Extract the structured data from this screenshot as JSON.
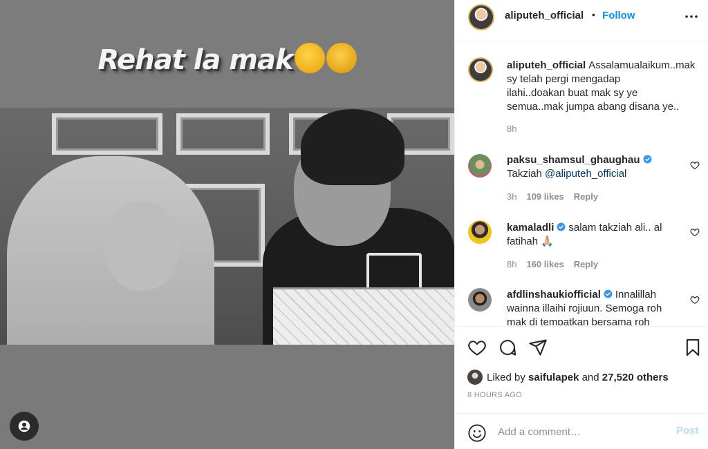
{
  "media": {
    "overlay_text": "Rehat la mak",
    "overlay_emojis": [
      "crying-face",
      "raised-hands"
    ]
  },
  "header": {
    "username": "aliputeh_official",
    "separator": "•",
    "follow_label": "Follow"
  },
  "comments": [
    {
      "username": "aliputeh_official",
      "verified": false,
      "text": "Assalamualaikum..mak sy telah pergi mengadap ilahi..doakan buat mak sy ye semua..mak jumpa abang disana ye..",
      "time": "8h"
    },
    {
      "username": "paksu_shamsul_ghaughau",
      "verified": true,
      "text_prefix": "Takziah ",
      "mention": "@aliputeh_official",
      "time": "3h",
      "likes": "109 likes",
      "reply_label": "Reply"
    },
    {
      "username": "kamaladli",
      "verified": true,
      "text": "salam takziah ali.. al fatihah 🙏🏼",
      "time": "8h",
      "likes": "160 likes",
      "reply_label": "Reply"
    },
    {
      "username": "afdlinshaukiofficial",
      "verified": true,
      "text": "Innalillah wainna illaihi rojiuun. Semoga roh mak di tempatkan bersama roh"
    }
  ],
  "likes": {
    "prefix": "Liked by",
    "user": "saifulapek",
    "conjunction": "and",
    "others": "27,520 others"
  },
  "timestamp": "8 HOURS AGO",
  "add_comment": {
    "placeholder": "Add a comment…",
    "post_label": "Post"
  },
  "colors": {
    "follow_blue": "#0095f6",
    "verified_blue": "#3897f0",
    "post_disabled": "#b2dffc",
    "meta_gray": "#8e8e8e",
    "text_dark": "#262626"
  }
}
